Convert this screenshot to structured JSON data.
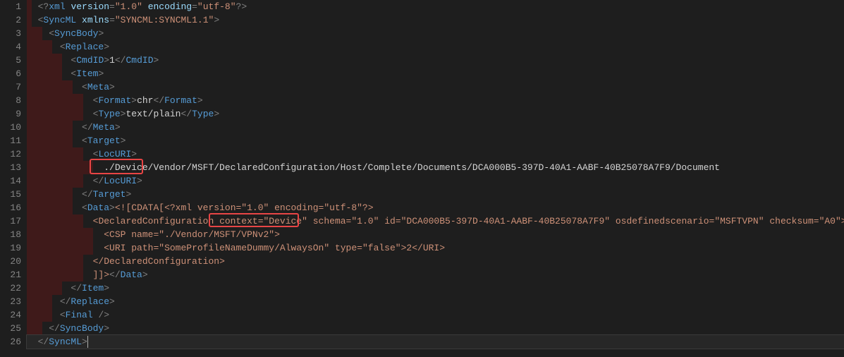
{
  "gutter": [
    "1",
    "2",
    "3",
    "4",
    "5",
    "6",
    "7",
    "8",
    "9",
    "10",
    "11",
    "12",
    "13",
    "14",
    "15",
    "16",
    "17",
    "18",
    "19",
    "20",
    "21",
    "22",
    "23",
    "24",
    "25",
    "26"
  ],
  "colors": {
    "highlight_box": "#e84545"
  },
  "tokens": {
    "xml": "xml",
    "version_attr": "version",
    "version_val": "\"1.0\"",
    "encoding_attr": "encoding",
    "encoding_val": "\"utf-8\"",
    "syncml": "SyncML",
    "xmlns_attr": "xmlns",
    "xmlns_val": "\"SYNCML:SYNCML1.1\"",
    "syncbody": "SyncBody",
    "replace": "Replace",
    "cmdid": "CmdID",
    "cmdid_val": "1",
    "item": "Item",
    "meta": "Meta",
    "format": "Format",
    "format_val": "chr",
    "type": "Type",
    "type_val": "text/plain",
    "target": "Target",
    "locuri": "LocURI",
    "locuri_path_prefix": "./Device/",
    "locuri_path_rest": "Vendor/MSFT/DeclaredConfiguration/Host/Complete/Documents/DCA000B5-397D-40A1-AABF-40B25078A7F9/Document",
    "data": "Data",
    "cdata_open": "<![CDATA[",
    "inner_xml_decl": "<?xml version=\"1.0\" encoding=\"utf-8\"?>",
    "declconfig": "DeclaredConfiguration",
    "context_attr": "context",
    "context_val": "\"Device\"",
    "schema_attr": "schema",
    "schema_val": "\"1.0\"",
    "id_attr": "id",
    "id_val": "\"DCA000B5-397D-40A1-AABF-40B25078A7F9\"",
    "osdef_attr": "osdefinedscenario",
    "osdef_val": "\"MSFTVPN\"",
    "checksum_attr": "checksum",
    "checksum_val": "\"A0\"",
    "csp": "CSP",
    "name_attr": "name",
    "csp_name_val": "\"./Vendor/MSFT/VPNv2\"",
    "uri": "URI",
    "path_attr": "path",
    "uri_path_val": "\"SomeProfileNameDummy/AlwaysOn\"",
    "type_attr": "type",
    "uri_type_val": "\"false\"",
    "uri_text": "2",
    "cdata_close": "]]>",
    "final": "Final"
  }
}
